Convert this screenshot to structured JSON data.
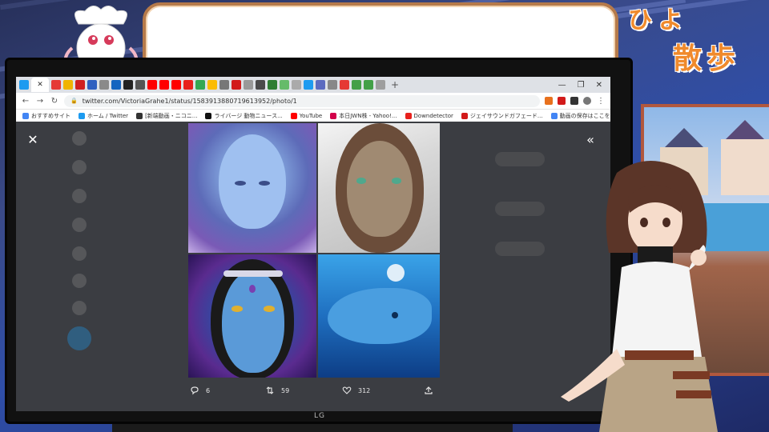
{
  "overlay": {
    "logo_line1": "ひよ",
    "logo_line2": "散歩",
    "bubble_text": ""
  },
  "monitor": {
    "brand": "LG"
  },
  "browser": {
    "url": "twitter.com/VictoriaGrahe1/status/1583913880719613952/photo/1",
    "nav": {
      "back": "←",
      "forward": "→",
      "reload": "↻"
    },
    "window_controls": [
      "—",
      "❐",
      "✕"
    ],
    "bookmarks": [
      {
        "label": "おすすめサイト",
        "color": "#4285f4"
      },
      {
        "label": "ホーム / Twitter",
        "color": "#1d9bf0"
      },
      {
        "label": "[新端動画・ニコニ...",
        "color": "#333333"
      },
      {
        "label": "ライバージ 動物ニュース...",
        "color": "#111111"
      },
      {
        "label": "YouTube",
        "color": "#ff0000"
      },
      {
        "label": "本日JWN株 - Yahoo!...",
        "color": "#d2004a"
      },
      {
        "label": "Downdetector",
        "color": "#e8211d"
      },
      {
        "label": "ジェイサウンドガフェード...",
        "color": "#d21a1a"
      },
      {
        "label": "動画の保存はここをク...",
        "color": "#4285f4"
      }
    ]
  },
  "viewer": {
    "close_icon": "✕",
    "collapse_icon": "«",
    "photos": [
      {
        "name": "blue-alien-portrait"
      },
      {
        "name": "lizard-woman-portrait"
      },
      {
        "name": "blue-elf-portrait"
      },
      {
        "name": "dolphin-underwater"
      }
    ],
    "actions": {
      "replies": "6",
      "retweets": "59",
      "likes": "312"
    }
  }
}
